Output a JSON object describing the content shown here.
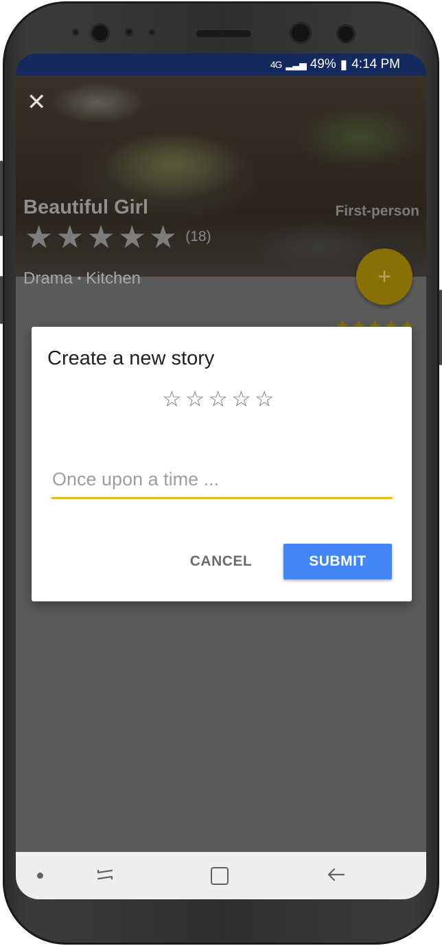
{
  "status_bar": {
    "network": "4G",
    "battery": "49%",
    "time": "4:14 PM"
  },
  "hero": {
    "close_icon": "close-icon",
    "title": "Beautiful Girl",
    "rating_count": "(18)",
    "genre": "Drama",
    "separator": "•",
    "location": "Kitchen",
    "perspective": "First-person",
    "stars": 5
  },
  "fab": {
    "label": "+"
  },
  "dialog": {
    "title": "Create a new story",
    "rating_stars": 5,
    "rating_value": 0,
    "input_placeholder": "Once upon a time ...",
    "input_value": "",
    "cancel_label": "CANCEL",
    "submit_label": "SUBMIT"
  },
  "colors": {
    "accent": "#f2b916",
    "primary_button": "#4285f4",
    "status_bar": "#14295e",
    "scrim": "#5b5b5b"
  },
  "nav_bar": {
    "icons": [
      "dot-icon",
      "recent-apps-icon",
      "home-icon",
      "back-icon"
    ]
  }
}
